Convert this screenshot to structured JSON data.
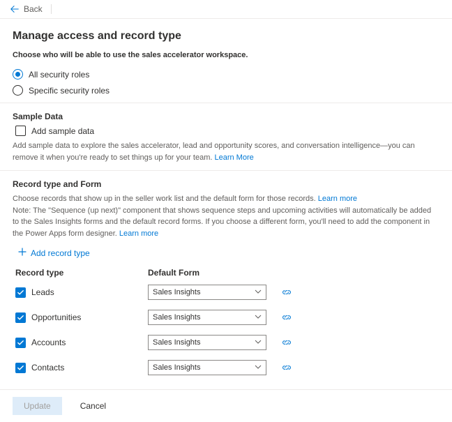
{
  "topbar": {
    "back": "Back"
  },
  "page": {
    "title": "Manage access and record type",
    "subtitle": "Choose who will be able to use the sales accelerator workspace."
  },
  "roles": {
    "options": [
      {
        "label": "All security roles",
        "selected": true
      },
      {
        "label": "Specific security roles",
        "selected": false
      }
    ]
  },
  "sampleData": {
    "title": "Sample Data",
    "checkboxLabel": "Add sample data",
    "checked": false,
    "help": "Add sample data to explore the sales accelerator, lead and opportunity scores, and conversation intelligence—you can remove it when you're ready to set things up for your team.",
    "learnMore": "Learn More"
  },
  "recordForm": {
    "title": "Record type and Form",
    "line1a": "Choose records that show up in the seller work list and the default form for those records.",
    "line1Link": "Learn more",
    "line2a": "Note: The \"Sequence (up next)\" component that shows sequence steps and upcoming activities will automatically be added to the Sales Insights forms and the default record forms. If you choose a different form, you'll need to add the component in the Power Apps form designer.",
    "line2Link": "Learn more",
    "add": "Add record type",
    "colType": "Record type",
    "colForm": "Default Form",
    "rows": [
      {
        "label": "Leads",
        "checked": true,
        "form": "Sales Insights"
      },
      {
        "label": "Opportunities",
        "checked": true,
        "form": "Sales Insights"
      },
      {
        "label": "Accounts",
        "checked": true,
        "form": "Sales Insights"
      },
      {
        "label": "Contacts",
        "checked": true,
        "form": "Sales Insights"
      }
    ]
  },
  "footer": {
    "update": "Update",
    "cancel": "Cancel"
  }
}
